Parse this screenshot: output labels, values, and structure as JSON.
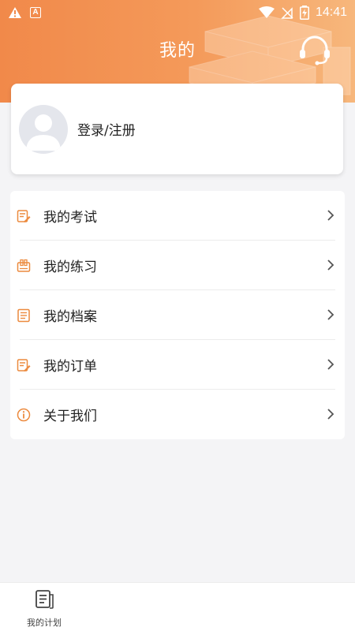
{
  "status_bar": {
    "time": "14:41",
    "icons": [
      "warning-icon",
      "a-badge-icon",
      "wifi-icon",
      "no-sim-icon",
      "battery-icon"
    ],
    "a_badge": "A"
  },
  "header": {
    "title": "我的",
    "support_icon": "headset-icon",
    "gradient": [
      "#f1894a",
      "#f7b77c"
    ]
  },
  "profile": {
    "login_label": "登录/注册",
    "avatar_icon": "default-avatar-icon"
  },
  "menu": {
    "items": [
      {
        "label": "我的考试",
        "icon": "exam-icon"
      },
      {
        "label": "我的练习",
        "icon": "practice-icon"
      },
      {
        "label": "我的档案",
        "icon": "archive-icon"
      },
      {
        "label": "我的订单",
        "icon": "order-icon"
      },
      {
        "label": "关于我们",
        "icon": "info-icon"
      }
    ]
  },
  "bottom_nav": {
    "items": [
      {
        "label": "我的计划",
        "icon": "plan-icon"
      }
    ]
  },
  "colors": {
    "accent": "#ec8a3e",
    "background": "#f4f4f6",
    "card": "#ffffff"
  }
}
